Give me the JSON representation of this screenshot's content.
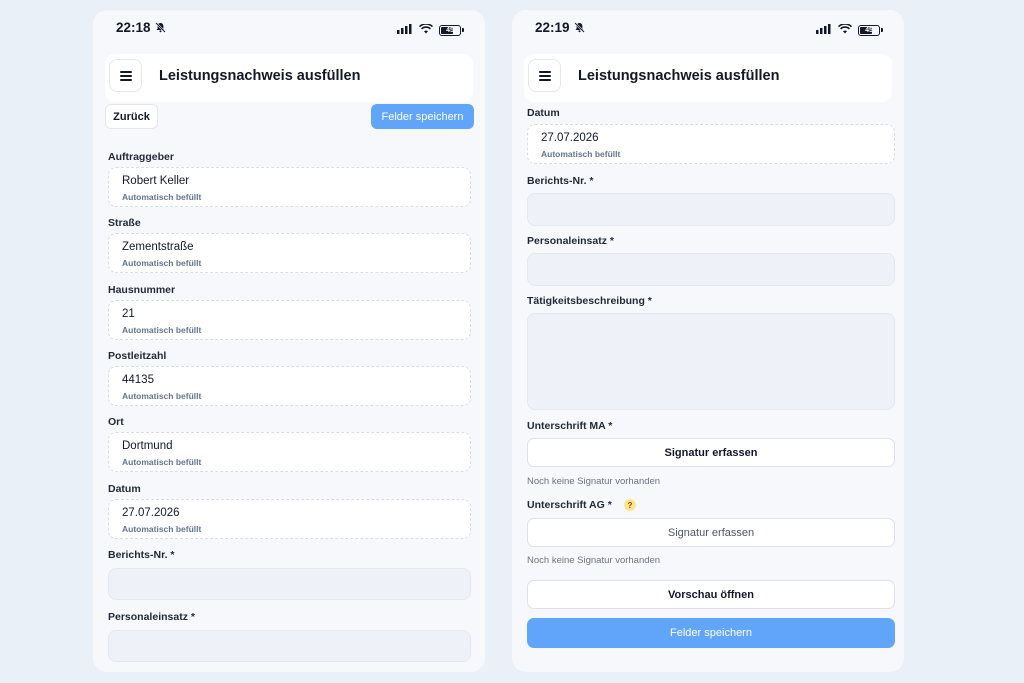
{
  "colors": {
    "accent": "#60a5fa",
    "background": "#eaf0f8",
    "help_badge": "#fde68a"
  },
  "left": {
    "status": {
      "time": "22:18",
      "battery": "45"
    },
    "header": {
      "menu_icon": "hamburger-icon",
      "title": "Leistungsnachweis ausfüllen"
    },
    "actions": {
      "back": "Zurück",
      "save": "Felder speichern"
    },
    "fields": [
      {
        "label": "Auftraggeber",
        "value": "Robert Keller",
        "hint": "Automatisch befüllt"
      },
      {
        "label": "Straße",
        "value": "Zementstraße",
        "hint": "Automatisch befüllt"
      },
      {
        "label": "Hausnummer",
        "value": "21",
        "hint": "Automatisch befüllt"
      },
      {
        "label": "Postleitzahl",
        "value": "44135",
        "hint": "Automatisch befüllt"
      },
      {
        "label": "Ort",
        "value": "Dortmund",
        "hint": "Automatisch befüllt"
      },
      {
        "label": "Datum",
        "value": "27.07.2026",
        "hint": "Automatisch befüllt"
      }
    ],
    "empty_fields": [
      {
        "label": "Berichts-Nr. *"
      },
      {
        "label": "Personaleinsatz *"
      }
    ]
  },
  "right": {
    "status": {
      "time": "22:19",
      "battery": "45"
    },
    "header": {
      "menu_icon": "hamburger-icon",
      "title": "Leistungsnachweis ausfüllen"
    },
    "date_field": {
      "label": "Datum",
      "value": "27.07.2026",
      "hint": "Automatisch befüllt"
    },
    "empty_fields": [
      {
        "label": "Berichts-Nr. *"
      },
      {
        "label": "Personaleinsatz *"
      },
      {
        "label": "Tätigkeitsbeschreibung *"
      }
    ],
    "signature_ma": {
      "label": "Unterschrift MA *",
      "button": "Signatur erfassen",
      "note": "Noch keine Signatur vorhanden"
    },
    "signature_ag": {
      "label": "Unterschrift AG *",
      "help": "?",
      "button": "Signatur erfassen",
      "note": "Noch keine Signatur vorhanden"
    },
    "preview_button": "Vorschau öffnen",
    "save_button": "Felder speichern"
  }
}
